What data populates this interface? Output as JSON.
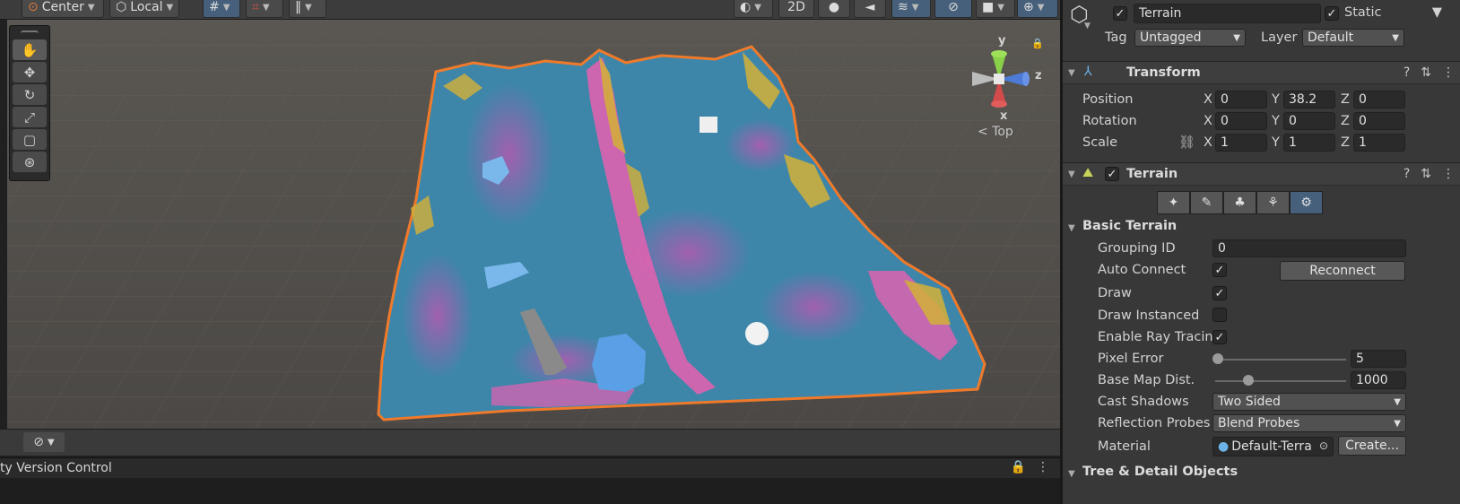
{
  "toolbar": {
    "pivot_label": "Center",
    "space_label": "Local",
    "mode_2d_label": "2D"
  },
  "scene": {
    "gizmo": {
      "y_label": "y",
      "z_label": "z",
      "x_label": "x",
      "view_label": "Top"
    },
    "colors": {
      "terrain": "#3a83a6",
      "magenta": "#d8449a",
      "yellow": "#d4b037",
      "outline": "#f07a2a",
      "bg": "#202020"
    }
  },
  "tools": [
    "hand-tool",
    "move-tool",
    "rotate-tool",
    "scale-tool",
    "rect-tool",
    "transform-tool"
  ],
  "version_control": {
    "title": "ty Version Control"
  },
  "inspector": {
    "object": {
      "name": "Terrain",
      "static_label": "Static",
      "tag_label": "Tag",
      "tag_value": "Untagged",
      "layer_label": "Layer",
      "layer_value": "Default",
      "active": true,
      "static": true
    },
    "transform": {
      "title": "Transform",
      "position_label": "Position",
      "rotation_label": "Rotation",
      "scale_label": "Scale",
      "x": "X",
      "y": "Y",
      "z": "Z",
      "position": {
        "x": "0",
        "y": "38.2",
        "z": "0"
      },
      "rotation": {
        "x": "0",
        "y": "0",
        "z": "0"
      },
      "scale": {
        "x": "1",
        "y": "1",
        "z": "1"
      }
    },
    "terrain": {
      "title": "Terrain",
      "section_basic": "Basic Terrain",
      "grouping_id_label": "Grouping ID",
      "grouping_id": "0",
      "auto_connect_label": "Auto Connect",
      "auto_connect": true,
      "reconnect_label": "Reconnect",
      "draw_label": "Draw",
      "draw": true,
      "draw_instanced_label": "Draw Instanced",
      "draw_instanced": false,
      "ray_tracing_label": "Enable Ray Tracin",
      "ray_tracing": true,
      "pixel_error_label": "Pixel Error",
      "pixel_error": "5",
      "pixel_error_fraction": 0.02,
      "base_map_label": "Base Map Dist.",
      "base_map": "1000",
      "base_map_fraction": 0.25,
      "cast_shadows_label": "Cast Shadows",
      "cast_shadows": "Two Sided",
      "reflection_label": "Reflection Probes",
      "reflection": "Blend Probes",
      "material_label": "Material",
      "material": "Default-Terra",
      "create_label": "Create...",
      "section_tree": "Tree & Detail Objects"
    }
  }
}
